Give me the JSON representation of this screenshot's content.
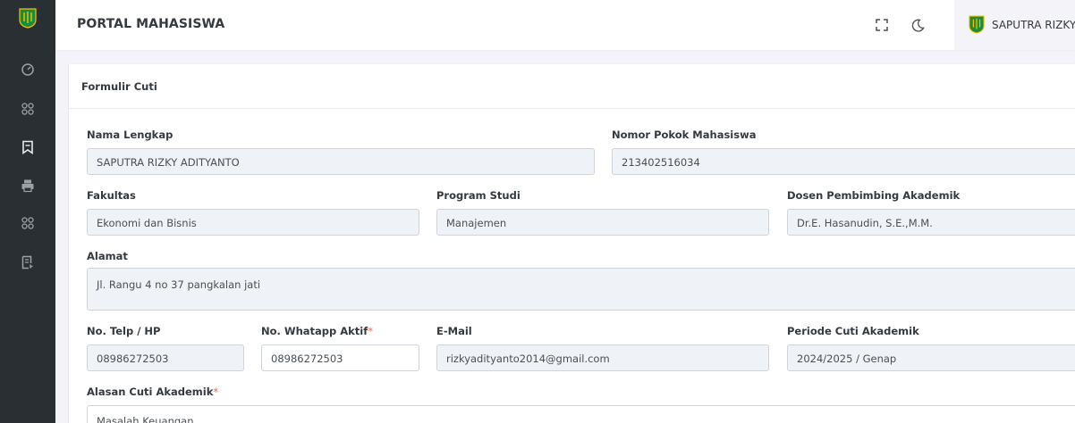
{
  "app": {
    "title": "PORTAL MAHASISWA",
    "user_name": "SAPUTRA RIZKY A"
  },
  "sidebar": {
    "items": [
      {
        "icon": "dashboard-icon"
      },
      {
        "icon": "apps-icon"
      },
      {
        "icon": "bookmark-icon"
      },
      {
        "icon": "printer-icon"
      },
      {
        "icon": "apps-icon"
      },
      {
        "icon": "document-icon"
      }
    ]
  },
  "form": {
    "header": "Formulir Cuti",
    "nama": {
      "label": "Nama Lengkap",
      "value": "SAPUTRA RIZKY ADITYANTO"
    },
    "npm": {
      "label": "Nomor Pokok Mahasiswa",
      "value": "213402516034"
    },
    "fakultas": {
      "label": "Fakultas",
      "value": "Ekonomi dan Bisnis"
    },
    "prodi": {
      "label": "Program Studi",
      "value": "Manajemen"
    },
    "dosen": {
      "label": "Dosen Pembimbing Akademik",
      "value": "Dr.E. Hasanudin, S.E.,M.M."
    },
    "alamat": {
      "label": "Alamat",
      "value": "Jl. Rangu 4 no 37 pangkalan jati"
    },
    "telp": {
      "label": "No. Telp / HP",
      "value": "08986272503"
    },
    "whatsapp": {
      "label": "No. Whatapp Aktif",
      "required": "*",
      "value": "08986272503"
    },
    "email": {
      "label": "E-Mail",
      "value": "rizkyadityanto2014@gmail.com"
    },
    "periode": {
      "label": "Periode Cuti Akademik",
      "value": "2024/2025 / Genap"
    },
    "alasan": {
      "label": "Alasan Cuti Akademik",
      "required": "*",
      "value": "Masalah Keuangan"
    }
  },
  "colors": {
    "sidebar_bg": "#2a2f34",
    "brand_green": "#1e8a3c",
    "brand_gold": "#f2c200",
    "required": "#f06548"
  }
}
